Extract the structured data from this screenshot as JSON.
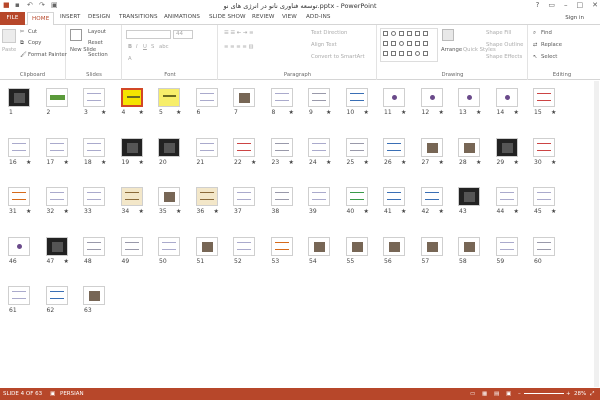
{
  "title": "توسعه فناوری نانو در انرژی های نو.pptx - PowerPoint",
  "window_controls": [
    "?",
    "▭",
    "–",
    "□",
    "✕"
  ],
  "tabs": [
    "FILE",
    "HOME",
    "INSERT",
    "DESIGN",
    "TRANSITIONS",
    "ANIMATIONS",
    "SLIDE SHOW",
    "REVIEW",
    "VIEW",
    "ADD-INS"
  ],
  "signin": "Sign in",
  "ribbon": {
    "clipboard": {
      "label": "Clipboard",
      "paste": "Paste",
      "cut": "Cut",
      "copy": "Copy",
      "format_painter": "Format Painter"
    },
    "slides": {
      "label": "Slides",
      "new_slide": "New Slide",
      "layout": "Layout",
      "reset": "Reset",
      "section": "Section"
    },
    "font": {
      "label": "Font",
      "size": "44",
      "bold": "B",
      "italic": "I",
      "underline": "U",
      "strike": "S",
      "abc": "abc"
    },
    "paragraph": {
      "label": "Paragraph",
      "text_direction": "Text Direction",
      "align_text": "Align Text",
      "smartart": "Convert to SmartArt"
    },
    "drawing": {
      "label": "Drawing",
      "arrange": "Arrange",
      "quick_styles": "Quick Styles",
      "shape_fill": "Shape Fill",
      "shape_outline": "Shape Outline",
      "shape_effects": "Shape Effects"
    },
    "editing": {
      "label": "Editing",
      "find": "Find",
      "replace": "Replace",
      "select": "Select"
    }
  },
  "slides": [
    {
      "n": "1",
      "star": "",
      "t": "dark"
    },
    {
      "n": "2",
      "star": "",
      "t": "logo"
    },
    {
      "n": "3",
      "star": "★",
      "t": "text"
    },
    {
      "n": "4",
      "star": "★",
      "t": "yellow",
      "sel": true
    },
    {
      "n": "5",
      "star": "★",
      "t": "yellow2"
    },
    {
      "n": "6",
      "star": "",
      "t": "text"
    },
    {
      "n": "7",
      "star": "",
      "t": "photo"
    },
    {
      "n": "8",
      "star": "★",
      "t": "text"
    },
    {
      "n": "9",
      "star": "★",
      "t": "diagram"
    },
    {
      "n": "10",
      "star": "★",
      "t": "blue"
    },
    {
      "n": "11",
      "star": "★",
      "t": "dot"
    },
    {
      "n": "12",
      "star": "★",
      "t": "dot"
    },
    {
      "n": "13",
      "star": "★",
      "t": "dot"
    },
    {
      "n": "14",
      "star": "★",
      "t": "dot"
    },
    {
      "n": "15",
      "star": "★",
      "t": "colorful"
    },
    {
      "n": "16",
      "star": "★",
      "t": "text"
    },
    {
      "n": "17",
      "star": "★",
      "t": "text"
    },
    {
      "n": "18",
      "star": "★",
      "t": "text"
    },
    {
      "n": "19",
      "star": "★",
      "t": "dark"
    },
    {
      "n": "20",
      "star": "",
      "t": "dark"
    },
    {
      "n": "21",
      "star": "",
      "t": "text"
    },
    {
      "n": "22",
      "star": "★",
      "t": "colorful"
    },
    {
      "n": "23",
      "star": "★",
      "t": "diagram"
    },
    {
      "n": "24",
      "star": "★",
      "t": "text"
    },
    {
      "n": "25",
      "star": "★",
      "t": "diagram"
    },
    {
      "n": "26",
      "star": "★",
      "t": "blue"
    },
    {
      "n": "27",
      "star": "★",
      "t": "photo"
    },
    {
      "n": "28",
      "star": "★",
      "t": "photo"
    },
    {
      "n": "29",
      "star": "★",
      "t": "dark"
    },
    {
      "n": "30",
      "star": "★",
      "t": "colorful"
    },
    {
      "n": "31",
      "star": "★",
      "t": "orange"
    },
    {
      "n": "32",
      "star": "★",
      "t": "text"
    },
    {
      "n": "33",
      "star": "",
      "t": "text"
    },
    {
      "n": "34",
      "star": "★",
      "t": "beige"
    },
    {
      "n": "35",
      "star": "★",
      "t": "photo"
    },
    {
      "n": "36",
      "star": "★",
      "t": "beige"
    },
    {
      "n": "37",
      "star": "",
      "t": "text"
    },
    {
      "n": "38",
      "star": "",
      "t": "diagram"
    },
    {
      "n": "39",
      "star": "",
      "t": "text"
    },
    {
      "n": "40",
      "star": "★",
      "t": "green"
    },
    {
      "n": "41",
      "star": "★",
      "t": "blue"
    },
    {
      "n": "42",
      "star": "★",
      "t": "blue"
    },
    {
      "n": "43",
      "star": "",
      "t": "dark"
    },
    {
      "n": "44",
      "star": "★",
      "t": "text"
    },
    {
      "n": "45",
      "star": "★",
      "t": "text"
    },
    {
      "n": "46",
      "star": "",
      "t": "dot"
    },
    {
      "n": "47",
      "star": "★",
      "t": "dark"
    },
    {
      "n": "48",
      "star": "",
      "t": "diagram"
    },
    {
      "n": "49",
      "star": "",
      "t": "diagram"
    },
    {
      "n": "50",
      "star": "",
      "t": "text"
    },
    {
      "n": "51",
      "star": "",
      "t": "photo"
    },
    {
      "n": "52",
      "star": "",
      "t": "text"
    },
    {
      "n": "53",
      "star": "",
      "t": "orange"
    },
    {
      "n": "54",
      "star": "",
      "t": "photo"
    },
    {
      "n": "55",
      "star": "",
      "t": "photo"
    },
    {
      "n": "56",
      "star": "",
      "t": "photo"
    },
    {
      "n": "57",
      "star": "",
      "t": "photo"
    },
    {
      "n": "58",
      "star": "",
      "t": "photo"
    },
    {
      "n": "59",
      "star": "",
      "t": "text"
    },
    {
      "n": "60",
      "star": "",
      "t": "diagram"
    },
    {
      "n": "61",
      "star": "",
      "t": "text"
    },
    {
      "n": "62",
      "star": "",
      "t": "blue"
    },
    {
      "n": "63",
      "star": "",
      "t": "photo"
    }
  ],
  "status": {
    "slide": "SLIDE 4 OF 63",
    "lang": "PERSIAN",
    "zoom": "28%"
  },
  "colors": {
    "accent": "#b7472a",
    "selected_border": "#d24726"
  }
}
